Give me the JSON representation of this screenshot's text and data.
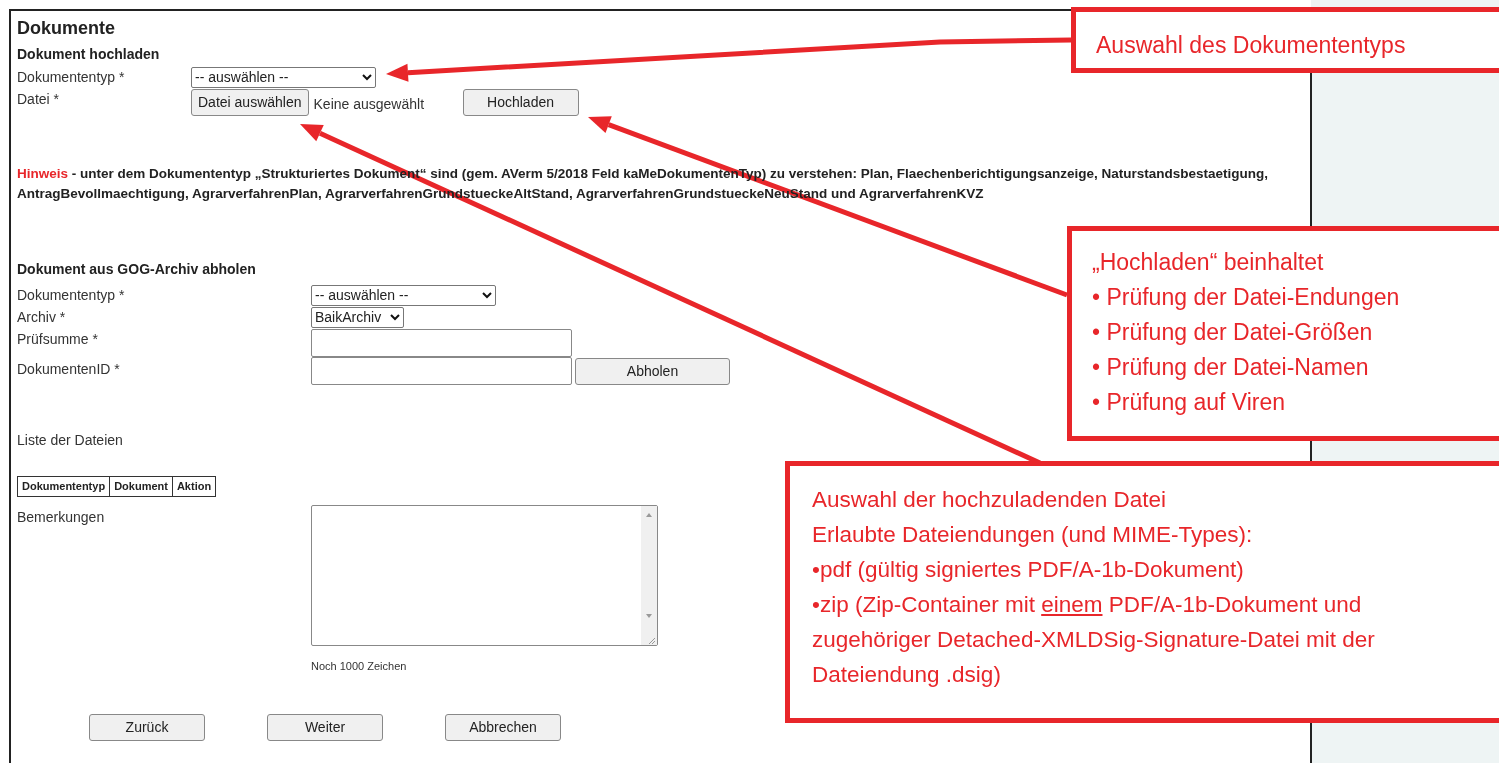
{
  "panel": {
    "title": "Dokumente",
    "upload": {
      "heading": "Dokument hochladen",
      "type_label": "Dokumententyp *",
      "type_value": "-- auswählen --",
      "file_label": "Datei *",
      "file_button": "Datei auswählen",
      "file_status": "Keine ausgewählt",
      "upload_button": "Hochladen"
    },
    "hint": {
      "label": "Hinweis",
      "text": "- unter dem Dokumententyp „Strukturiertes Dokument“ sind (gem. AVerm 5/2018 Feld kaMeDokumentenTyp) zu verstehen: Plan, Flaechenberichtigungsanzeige, Naturstandsbestaetigung, AntragBevollmaechtigung, AgrarverfahrenPlan, AgrarverfahrenGrundstueckeAltStand, AgrarverfahrenGrundstueckeNeuStand und AgrarverfahrenKVZ"
    },
    "archive": {
      "heading": "Dokument aus GOG-Archiv abholen",
      "type_label": "Dokumententyp *",
      "type_value": "-- auswählen --",
      "archive_label": "Archiv *",
      "archive_value": "BaikArchiv",
      "checksum_label": "Prüfsumme *",
      "id_label": "DokumentenID *",
      "fetch_button": "Abholen"
    },
    "files": {
      "heading": "Liste der Dateien",
      "columns": [
        "Dokumententyp",
        "Dokument",
        "Aktion"
      ]
    },
    "remarks": {
      "label": "Bemerkungen",
      "counter": "Noch 1000 Zeichen"
    },
    "buttons": [
      "Zurück",
      "Weiter",
      "Abbrechen"
    ]
  },
  "callouts": [
    {
      "lines": [
        [
          {
            "text": "Auswahl des Dokumententyps"
          }
        ]
      ]
    },
    {
      "lines": [
        [
          {
            "text": "„Hochladen“ beinhaltet"
          }
        ],
        [
          {
            "text": "• Prüfung der Datei-Endungen"
          }
        ],
        [
          {
            "text": "• Prüfung der Datei-Größen"
          }
        ],
        [
          {
            "text": "• Prüfung der Datei-Namen"
          }
        ],
        [
          {
            "text": "• Prüfung auf Viren"
          }
        ]
      ]
    },
    {
      "lines": [
        [
          {
            "text": "Auswahl der hochzuladenden Datei"
          }
        ],
        [
          {
            "text": "Erlaubte Dateiendungen (und MIME-Types):"
          }
        ],
        [
          {
            "text": "•pdf (gültig signiertes PDF/A-1b-Dokument)"
          }
        ],
        [
          {
            "text": "•zip (Zip-Container mit "
          },
          {
            "text": "einem",
            "underline": true
          },
          {
            "text": " PDF/A-1b-Dokument und zugehöriger Detached-XMLDSig-Signature-Datei mit der Dateiendung .dsig)"
          }
        ]
      ]
    }
  ]
}
